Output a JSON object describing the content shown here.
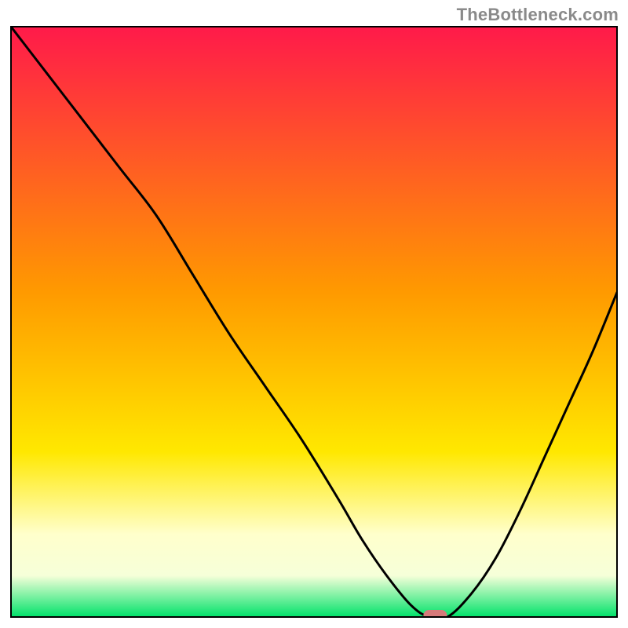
{
  "attribution": "TheBottleneck.com",
  "colors": {
    "gradient_top": "#ff1a4a",
    "gradient_upper_mid": "#ff9a00",
    "gradient_mid": "#ffe800",
    "gradient_lower1": "#ffffcc",
    "gradient_lower2": "#f6ffd9",
    "gradient_bottom": "#00e26a",
    "curve": "#000000",
    "marker": "#d67a7a"
  },
  "chart_data": {
    "type": "line",
    "title": "",
    "xlabel": "",
    "ylabel": "",
    "xlim": [
      0,
      100
    ],
    "ylim": [
      0,
      100
    ],
    "series": [
      {
        "name": "bottleneck-curve",
        "x": [
          0,
          6,
          12,
          18,
          24,
          30,
          36,
          42,
          48,
          54,
          58,
          62,
          66,
          69,
          72,
          76,
          80,
          84,
          88,
          92,
          96,
          100
        ],
        "y": [
          100,
          92,
          84,
          76,
          68,
          58,
          48,
          39,
          30,
          20,
          13,
          7,
          2,
          0,
          0,
          4,
          10,
          18,
          27,
          36,
          45,
          55
        ]
      }
    ],
    "annotations": [
      {
        "name": "optimal-marker",
        "x": 70,
        "y": 0
      }
    ]
  }
}
